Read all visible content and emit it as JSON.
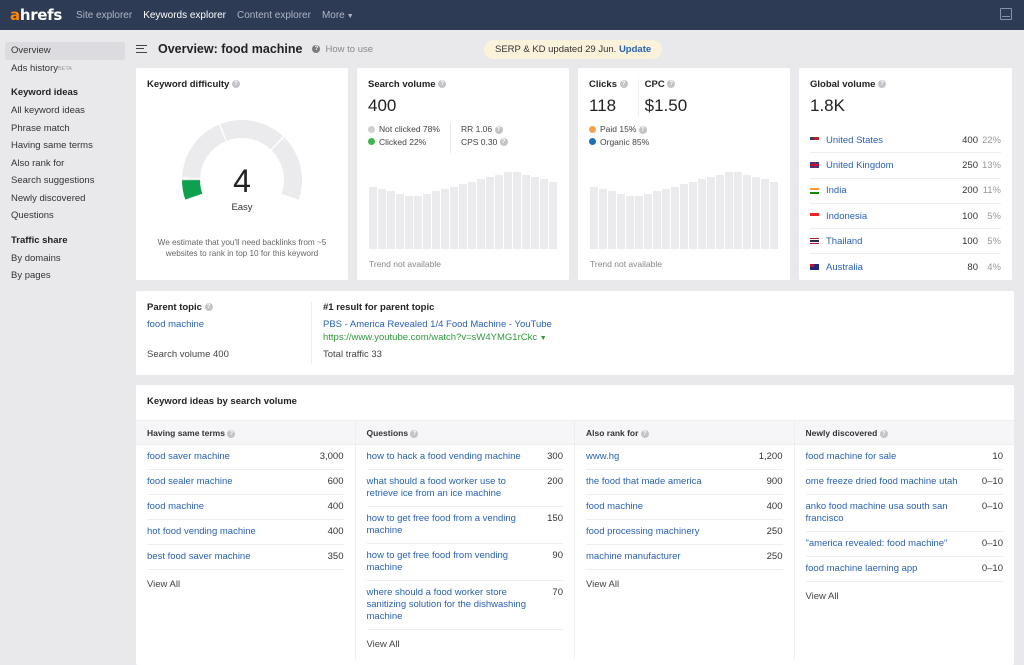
{
  "topbar": {
    "logo_a": "a",
    "logo_rest": "hrefs",
    "nav": [
      "Site explorer",
      "Keywords explorer",
      "Content explorer",
      "More"
    ],
    "active_nav": "Keywords explorer",
    "right_icon": "monitor-icon"
  },
  "sidebar": {
    "overview": "Overview",
    "ads_history": "Ads history",
    "ads_badge": "BETA",
    "keyword_ideas_head": "Keyword ideas",
    "keyword_ideas": [
      "All keyword ideas",
      "Phrase match",
      "Having same terms",
      "Also rank for",
      "Search suggestions",
      "Newly discovered",
      "Questions"
    ],
    "traffic_share_head": "Traffic share",
    "traffic_share": [
      "By domains",
      "By pages"
    ]
  },
  "header": {
    "title": "Overview: food machine",
    "how_to_use": "How to use",
    "update_notice": "SERP & KD updated 29 Jun.",
    "update_link": "Update"
  },
  "kd": {
    "title": "Keyword difficulty",
    "value": "4",
    "score": 4,
    "label": "Easy",
    "note": "We estimate that you'll need backlinks from ~5 websites to rank in top 10 for this keyword",
    "accent": "#0e9f4f"
  },
  "search_volume": {
    "title": "Search volume",
    "value": "400",
    "not_clicked": "Not clicked 78%",
    "clicked": "Clicked 22%",
    "rr": "RR 1.06",
    "cps": "CPS 0.30",
    "trend_note": "Trend not available",
    "colors": {
      "not_clicked": "#d0d0d4",
      "clicked": "#3fb34f"
    }
  },
  "clicks": {
    "title": "Clicks",
    "value": "118",
    "cpc_title": "CPC",
    "cpc_value": "$1.50",
    "paid": "Paid 15%",
    "organic": "Organic 85%",
    "trend_note": "Trend not available",
    "colors": {
      "paid": "#f7a24b",
      "organic": "#1f6fb5"
    }
  },
  "global_volume": {
    "title": "Global volume",
    "value": "1.8K",
    "countries": [
      {
        "name": "United States",
        "volume": "400",
        "pct": "22%",
        "flag": "us"
      },
      {
        "name": "United Kingdom",
        "volume": "250",
        "pct": "13%",
        "flag": "gb"
      },
      {
        "name": "India",
        "volume": "200",
        "pct": "11%",
        "flag": "in"
      },
      {
        "name": "Indonesia",
        "volume": "100",
        "pct": "5%",
        "flag": "id"
      },
      {
        "name": "Thailand",
        "volume": "100",
        "pct": "5%",
        "flag": "th"
      },
      {
        "name": "Australia",
        "volume": "80",
        "pct": "4%",
        "flag": "au"
      }
    ]
  },
  "parent_topic": {
    "title": "Parent topic",
    "topic": "food machine",
    "search_volume": "Search volume 400",
    "result_title": "#1 result for parent topic",
    "result_link": "PBS - America Revealed 1/4 Food Machine - YouTube",
    "result_url": "https://www.youtube.com/watch?v=sW4YMG1rCkc",
    "total_traffic": "Total traffic 33"
  },
  "keyword_ideas": {
    "title": "Keyword ideas by search volume",
    "view_all": "View All",
    "columns": [
      {
        "title": "Having same terms",
        "items": [
          {
            "kw": "food saver machine",
            "vol": "3,000"
          },
          {
            "kw": "food sealer machine",
            "vol": "600"
          },
          {
            "kw": "food machine",
            "vol": "400"
          },
          {
            "kw": "hot food vending machine",
            "vol": "400"
          },
          {
            "kw": "best food saver machine",
            "vol": "350"
          }
        ]
      },
      {
        "title": "Questions",
        "items": [
          {
            "kw": "how to hack a food vending machine",
            "vol": "300"
          },
          {
            "kw": "what should a food worker use to retrieve ice from an ice machine",
            "vol": "200"
          },
          {
            "kw": "how to get free food from a vending machine",
            "vol": "150"
          },
          {
            "kw": "how to get free food from vending machine",
            "vol": "90"
          },
          {
            "kw": "where should a food worker store sanitizing solution for the dishwashing machine",
            "vol": "70"
          }
        ]
      },
      {
        "title": "Also rank for",
        "items": [
          {
            "kw": "www.hg",
            "vol": "1,200"
          },
          {
            "kw": "the food that made america",
            "vol": "900"
          },
          {
            "kw": "food machine",
            "vol": "400"
          },
          {
            "kw": "food processing machinery",
            "vol": "250"
          },
          {
            "kw": "machine manufacturer",
            "vol": "250"
          }
        ]
      },
      {
        "title": "Newly discovered",
        "items": [
          {
            "kw": "food machine for sale",
            "vol": "10"
          },
          {
            "kw": "ome freeze dried food machine utah",
            "vol": "0–10"
          },
          {
            "kw": "anko food machine usa south san francisco",
            "vol": "0–10"
          },
          {
            "kw": "\"america revealed: food machine\"",
            "vol": "0–10"
          },
          {
            "kw": "food machine laerning app",
            "vol": "0–10"
          }
        ]
      }
    ]
  }
}
